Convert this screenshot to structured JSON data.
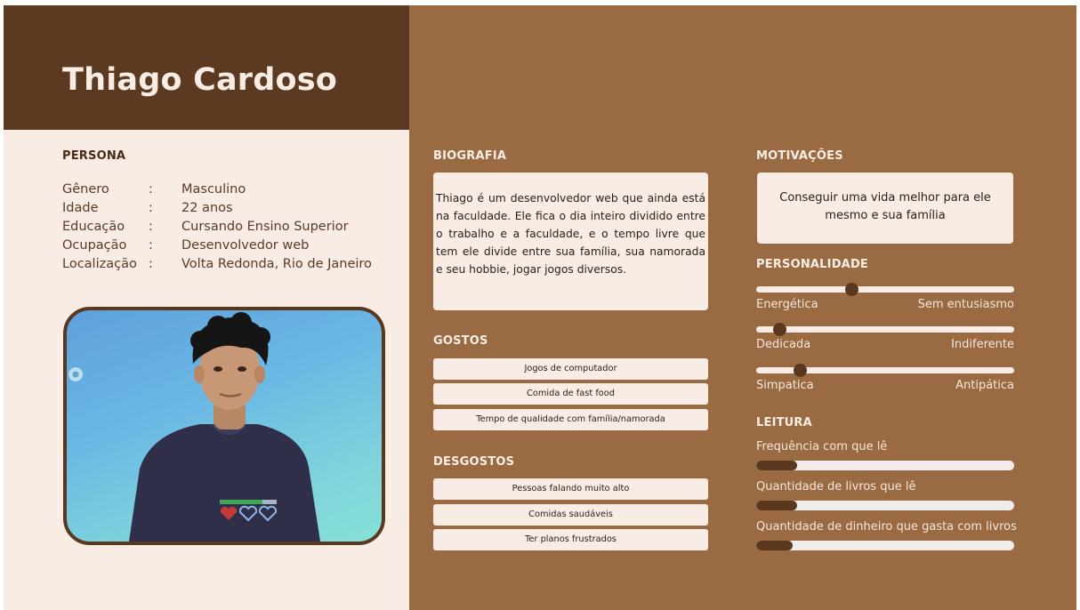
{
  "persona": {
    "name": "Thiago Cardoso",
    "heading": "PERSONA",
    "fields": [
      {
        "label": "Gênero",
        "sep": ":",
        "value": "Masculino"
      },
      {
        "label": "Idade",
        "sep": ":",
        "value": "22 anos"
      },
      {
        "label": "Educação",
        "sep": ":",
        "value": "Cursando Ensino Superior"
      },
      {
        "label": "Ocupação",
        "sep": ":",
        "value": "Desenvolvedor web"
      },
      {
        "label": "Localização",
        "sep": ":",
        "value": "Volta Redonda, Rio de Janeiro"
      }
    ]
  },
  "biography": {
    "heading": "BIOGRAFIA",
    "text": "Thiago é um desenvolvedor web que ainda está na faculdade. Ele fica o dia inteiro dividido entre o trabalho e a faculdade, e o tempo livre que tem ele divide entre sua família, sua namorada e seu hobbie, jogar jogos diversos."
  },
  "likes": {
    "heading": "GOSTOS",
    "items": [
      "Jogos de computador",
      "Comida de fast food",
      "Tempo de qualidade com família/namorada"
    ]
  },
  "dislikes": {
    "heading": "DESGOSTOS",
    "items": [
      "Pessoas falando muito alto",
      "Comidas saudáveis",
      "Ter planos frustrados"
    ]
  },
  "motivations": {
    "heading": "MOTIVAÇÕES",
    "text": "Conseguir uma vida melhor para ele mesmo e sua família"
  },
  "personality": {
    "heading": "PERSONALIDADE",
    "traits": [
      {
        "left": "Energética",
        "right": "Sem entusiasmo",
        "level": 0.37
      },
      {
        "left": "Dedicada",
        "right": "Indiferente",
        "level": 0.09
      },
      {
        "left": "Simpatica",
        "right": "Antipática",
        "level": 0.17
      }
    ]
  },
  "reading": {
    "heading": "LEITURA",
    "metrics": [
      {
        "label": "Frequência com que lê",
        "level": 0.16
      },
      {
        "label": "Quantidade de livros que lê",
        "level": 0.16
      },
      {
        "label": "Quantidade de dinheiro que gasta com livros",
        "level": 0.14
      }
    ]
  },
  "colors": {
    "header": "#5c3a22",
    "left_panel": "#f8ece5",
    "right_panel": "#9a6a42",
    "accent_dark": "#5a3820"
  },
  "icons": {
    "photo": "persona-photo",
    "photo_badge": "sim-badge-icon"
  }
}
